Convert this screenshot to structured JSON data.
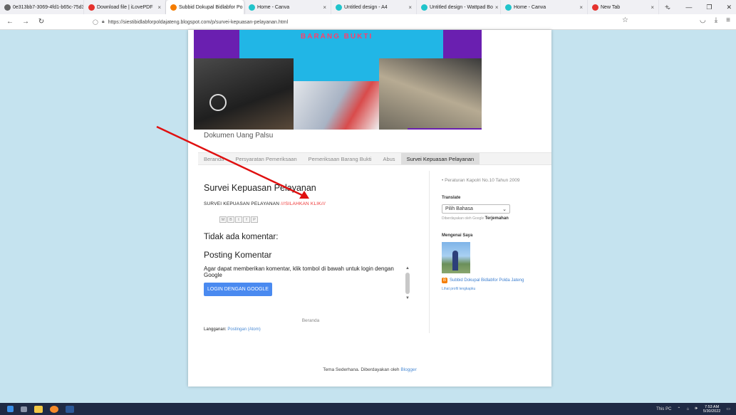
{
  "browser": {
    "tabs": [
      {
        "label": "0e313bb7-3069-4fd1-b65c-75d3e",
        "color": "#666666",
        "active": false
      },
      {
        "label": "Download file | iLovePDF",
        "color": "#e5322d",
        "active": false
      },
      {
        "label": "Subbid Dokupal Bidlabfor Po",
        "color": "#f57d00",
        "active": true
      },
      {
        "label": "Home - Canva",
        "color": "#20c4cb",
        "active": false
      },
      {
        "label": "Untitled design - A4",
        "color": "#20c4cb",
        "active": false
      },
      {
        "label": "Untitled design - Wattpad Bo",
        "color": "#20c4cb",
        "active": false
      },
      {
        "label": "Home - Canva",
        "color": "#20c4cb",
        "active": false
      },
      {
        "label": "New Tab",
        "color": "#e5322d",
        "active": false
      }
    ],
    "url": "https://siestibidlabforpoldajateng.blogspot.com/p/survei-kepuasan-pelayanan.html"
  },
  "blog": {
    "title": "Dokumen Uang Palsu",
    "banner_text": "BARANG BUKTI",
    "nav_tabs": [
      "Beranda",
      "Persyaratan Pemeriksaan",
      "Pemeriksaan Barang Bukti",
      "Abus",
      "Survei Kepuasan Pelayanan"
    ],
    "active_tab": "Survei Kepuasan Pelayanan"
  },
  "post": {
    "title": "Survei Kepuasan Pelayanan",
    "body_prefix": "SURVEI KEPUASAN PELAYANAN ",
    "body_link": "///SILAHKAN KLIK///",
    "share_buttons": [
      "M",
      "B",
      "t",
      "f",
      "P"
    ],
    "no_comments": "Tidak ada komentar:",
    "post_comment_title": "Posting Komentar",
    "comment_prompt": "Agar dapat memberikan komentar, klik tombol di bawah untuk login dengan Google",
    "login_button": "LOGIN DENGAN GOOGLE",
    "home_link": "Beranda",
    "subscribe_label": "Langganan: ",
    "subscribe_link": "Postingan (Atom)"
  },
  "sidebar": {
    "top_link": "Peraturan Kapolri No.10 Tahun 2009",
    "translate_title": "Translate",
    "language_select": "Pilih Bahasa",
    "powered_prefix": "Diberdayakan oleh ",
    "powered_google": "Google",
    "powered_suffix": "Terjemahan",
    "about_title": "Mengenai Saya",
    "profile_name": "Subbid Dokupal Bidlabfor Polda Jateng",
    "profile_link": "Lihat profil lengkapku"
  },
  "footer": {
    "text": "Tema Sederhana. Diberdayakan oleh ",
    "link": "Blogger"
  },
  "taskbar": {
    "tray_label": "This PC",
    "time": "7:53 AM",
    "date": "5/30/2022"
  },
  "colors": {
    "accent_link": "#e33333",
    "banner_purple": "#6a1fb0",
    "banner_cyan": "#21b6e6",
    "button_blue": "#4a8af0",
    "arrow_red": "#e01010"
  }
}
